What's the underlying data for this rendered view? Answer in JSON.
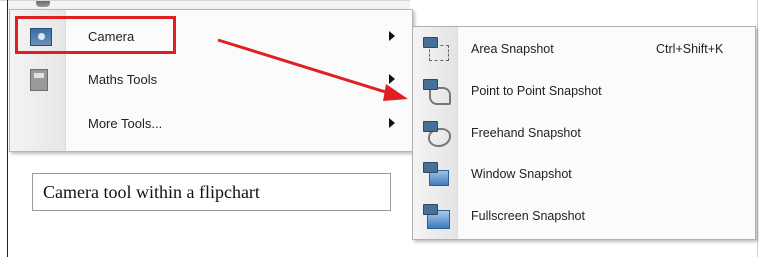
{
  "main_menu": {
    "items": [
      {
        "label": "Camera",
        "icon": "camera-icon",
        "has_submenu": true,
        "highlighted": true
      },
      {
        "label": "Maths Tools",
        "icon": "calculator-icon",
        "has_submenu": true
      },
      {
        "label": "More Tools...",
        "icon": "",
        "has_submenu": true
      }
    ]
  },
  "caption": "Camera tool within a flipchart",
  "submenu": {
    "items": [
      {
        "label": "Area Snapshot",
        "shortcut": "Ctrl+Shift+K",
        "icon": "area-snapshot-icon"
      },
      {
        "label": "Point to Point Snapshot",
        "shortcut": "",
        "icon": "point-to-point-snapshot-icon"
      },
      {
        "label": "Freehand Snapshot",
        "shortcut": "",
        "icon": "freehand-snapshot-icon"
      },
      {
        "label": "Window Snapshot",
        "shortcut": "",
        "icon": "window-snapshot-icon"
      },
      {
        "label": "Fullscreen Snapshot",
        "shortcut": "",
        "icon": "fullscreen-snapshot-icon"
      }
    ]
  },
  "colors": {
    "highlight_border": "#e02020",
    "annotation_arrow": "#e02020"
  }
}
